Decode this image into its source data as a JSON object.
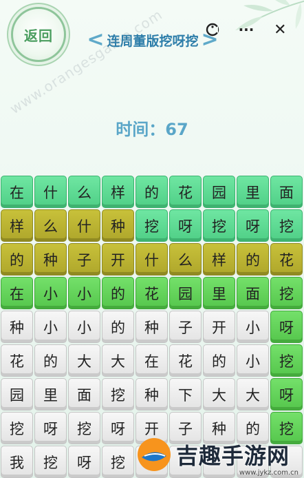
{
  "header": {
    "back_label": "返回",
    "title": "连周董版挖呀挖",
    "left_chevron": "<",
    "right_chevron": ">"
  },
  "capsule": {
    "more_label": "···",
    "close_label": "✕"
  },
  "watermark": "www.orangesgame.com",
  "timer": {
    "text": "时间：67"
  },
  "grid": {
    "rows": [
      {
        "style": [
          "light",
          "light",
          "light",
          "light",
          "light",
          "light",
          "light",
          "light",
          "light"
        ],
        "chars": [
          "在",
          "什",
          "么",
          "样",
          "的",
          "花",
          "园",
          "里",
          "面"
        ]
      },
      {
        "style": [
          "olive",
          "olive",
          "olive",
          "olive",
          "light",
          "light",
          "light",
          "light",
          "light"
        ],
        "chars": [
          "样",
          "么",
          "什",
          "种",
          "挖",
          "呀",
          "挖",
          "呀",
          "挖"
        ]
      },
      {
        "style": [
          "olive",
          "olive",
          "olive",
          "olive",
          "olive",
          "olive",
          "olive",
          "olive",
          "olive"
        ],
        "chars": [
          "的",
          "种",
          "子",
          "开",
          "什",
          "么",
          "样",
          "的",
          "花"
        ]
      },
      {
        "style": [
          "green",
          "green",
          "green",
          "green",
          "green",
          "green",
          "green",
          "green",
          "green"
        ],
        "chars": [
          "在",
          "小",
          "小",
          "的",
          "花",
          "园",
          "里",
          "面",
          "挖"
        ]
      },
      {
        "style": [
          "white",
          "white",
          "white",
          "white",
          "white",
          "white",
          "white",
          "white",
          "green"
        ],
        "chars": [
          "种",
          "小",
          "小",
          "的",
          "种",
          "子",
          "开",
          "小",
          "呀"
        ]
      },
      {
        "style": [
          "white",
          "white",
          "white",
          "white",
          "white",
          "white",
          "white",
          "white",
          "green"
        ],
        "chars": [
          "花",
          "的",
          "大",
          "大",
          "在",
          "花",
          "的",
          "小",
          "挖"
        ]
      },
      {
        "style": [
          "white",
          "white",
          "white",
          "white",
          "white",
          "white",
          "white",
          "white",
          "green"
        ],
        "chars": [
          "园",
          "里",
          "面",
          "挖",
          "种",
          "下",
          "大",
          "大",
          "呀"
        ]
      },
      {
        "style": [
          "white",
          "white",
          "white",
          "white",
          "white",
          "white",
          "white",
          "white",
          "green"
        ],
        "chars": [
          "挖",
          "呀",
          "挖",
          "呀",
          "开",
          "子",
          "种",
          "的",
          "挖"
        ]
      },
      {
        "style": [
          "white",
          "white",
          "white",
          "white",
          "white",
          "white",
          "white",
          "white",
          "white"
        ],
        "chars": [
          "我",
          "挖",
          "呀",
          "挖",
          "",
          "",
          "",
          "",
          ""
        ]
      }
    ]
  },
  "logo": {
    "text": "吉趣手游网",
    "url": "www.jykz.com.cn"
  },
  "colors": {
    "title": "#2e7eaa",
    "timer": "#5aa6c8",
    "tile_light": "#5fdc95",
    "tile_olive": "#bdb534",
    "tile_green": "#63d35a",
    "tile_white": "#eeeeee"
  }
}
